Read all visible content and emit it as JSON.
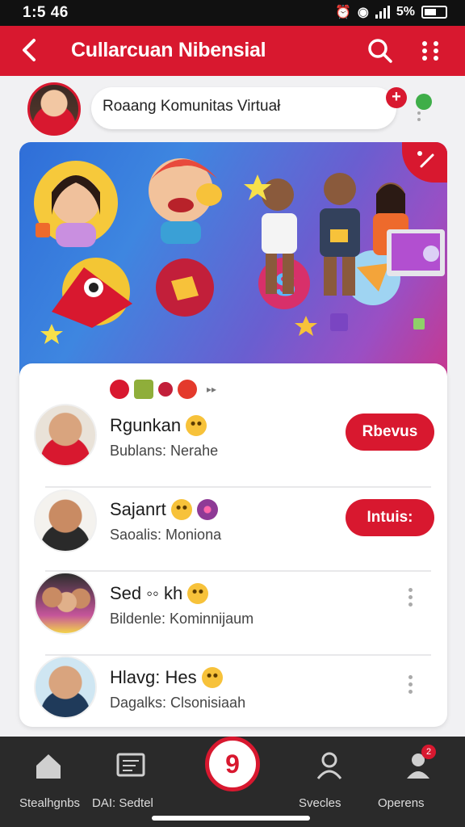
{
  "status_bar": {
    "time": "1:5 46",
    "battery_text": "5%"
  },
  "app_bar": {
    "title": "Cullarcuan Nibensial"
  },
  "profile": {
    "room_name": "Roaang Komunitas Virtuał",
    "add_symbol": "+"
  },
  "list": {
    "items": [
      {
        "name": "Rgunkan",
        "subtitle": "Bublans: Nerahe",
        "action": "Rbevus"
      },
      {
        "name": "Sajanrt",
        "subtitle": "Saoalis: Monionа",
        "action": "Intuis:"
      },
      {
        "name": "Sed ◦◦ kh",
        "subtitle": "Bildenle: Kominnijaum"
      },
      {
        "name": "Hlavg: Hes",
        "subtitle": "Dagalks: Clsonisiaah"
      }
    ]
  },
  "bottom_nav": {
    "left_label": "Stealhgnbs",
    "left2_label": "DAI: Sedtel",
    "fab_label": "9",
    "right1_label": "Svecles",
    "right2_label": "Operens",
    "badge": "2"
  },
  "colors": {
    "accent": "#d8182f",
    "nav_bg": "#2a2a2a",
    "background": "#f1f1f3"
  }
}
